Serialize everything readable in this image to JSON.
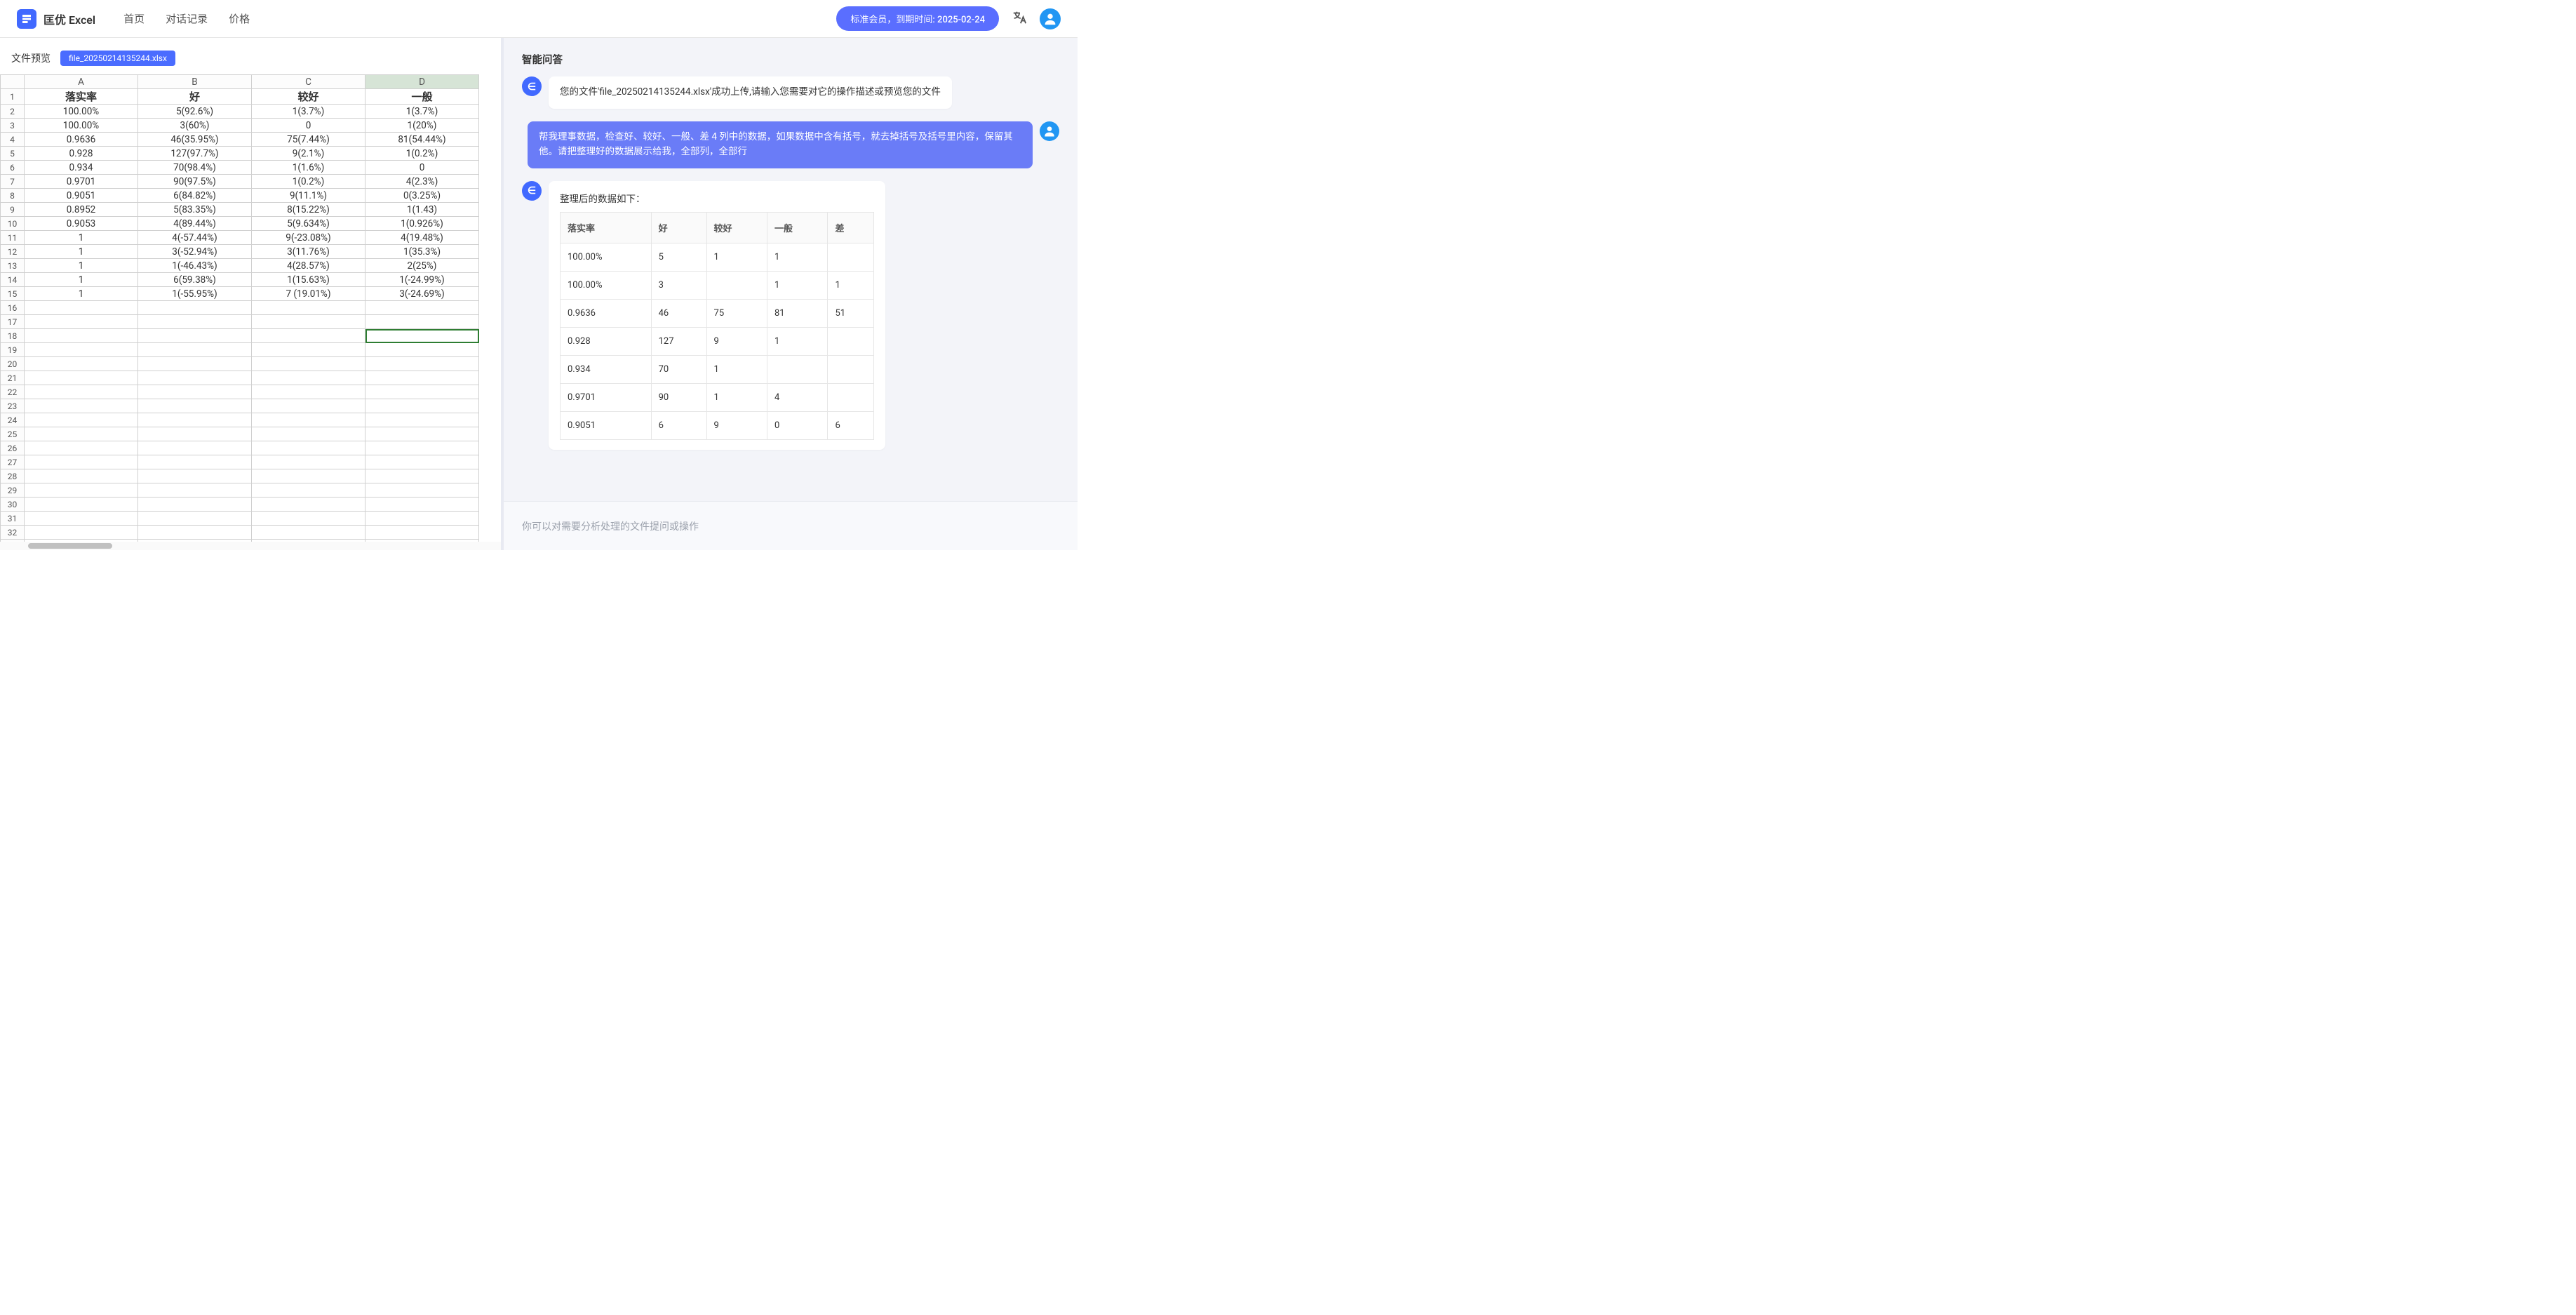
{
  "header": {
    "app_name": "匡优 Excel",
    "nav": {
      "home": "首页",
      "history": "对话记录",
      "pricing": "价格"
    },
    "member_badge": "标准会员，到期时间: 2025-02-24"
  },
  "left": {
    "preview_label": "文件预览",
    "file_name": "file_20250214135244.xlsx",
    "columns": [
      "A",
      "B",
      "C",
      "D"
    ],
    "selected_column_index": 3,
    "selected_cell": {
      "row": 18,
      "col": 3
    },
    "row_count": 34,
    "data_rows": [
      [
        "落实率",
        "好",
        "较好",
        "一般"
      ],
      [
        "100.00%",
        "5(92.6%)",
        "1(3.7%)",
        "1(3.7%)"
      ],
      [
        "100.00%",
        "3(60%)",
        "0",
        "1(20%)"
      ],
      [
        "0.9636",
        "46(35.95%)",
        "75(7.44%)",
        "81(54.44%)"
      ],
      [
        "0.928",
        "127(97.7%)",
        "9(2.1%)",
        "1(0.2%)"
      ],
      [
        "0.934",
        "70(98.4%)",
        "1(1.6%)",
        "0"
      ],
      [
        "0.9701",
        "90(97.5%)",
        "1(0.2%)",
        "4(2.3%)"
      ],
      [
        "0.9051",
        "6(84.82%)",
        "9(11.1%)",
        "0(3.25%)"
      ],
      [
        "0.8952",
        "5(83.35%)",
        "8(15.22%)",
        "1(1.43)"
      ],
      [
        "0.9053",
        "4(89.44%)",
        "5(9.634%)",
        "1(0.926%)"
      ],
      [
        "1",
        "4(-57.44%)",
        "9(-23.08%)",
        "4(19.48%)"
      ],
      [
        "1",
        "3(-52.94%)",
        "3(11.76%)",
        "1(35.3%)"
      ],
      [
        "1",
        "1(-46.43%)",
        "4(28.57%)",
        "2(25%)"
      ],
      [
        "1",
        "6(59.38%)",
        "1(15.63%)",
        "1(-24.99%)"
      ],
      [
        "1",
        "1(-55.95%)",
        "7 (19.01%)",
        "3(-24.69%)"
      ]
    ]
  },
  "chat": {
    "title": "智能问答",
    "bot_greeting": "您的文件'file_20250214135244.xlsx'成功上传,请输入您需要对它的操作描述或预览您的文件",
    "user_msg": "帮我理事数据，检查好、较好、一般、差 4 列中的数据，如果数据中含有括号，就去掉括号及括号里内容，保留其他。请把整理好的数据展示给我，全部列，全部行",
    "bot_reply_title": "整理后的数据如下：",
    "result_table": {
      "headers": [
        "落实率",
        "好",
        "较好",
        "一般",
        "差"
      ],
      "rows": [
        [
          "100.00%",
          "5",
          "1",
          "1",
          ""
        ],
        [
          "100.00%",
          "3",
          "",
          "1",
          "1"
        ],
        [
          "0.9636",
          "46",
          "75",
          "81",
          "51"
        ],
        [
          "0.928",
          "127",
          "9",
          "1",
          ""
        ],
        [
          "0.934",
          "70",
          "1",
          "",
          ""
        ],
        [
          "0.9701",
          "90",
          "1",
          "4",
          ""
        ],
        [
          "0.9051",
          "6",
          "9",
          "0",
          "6"
        ]
      ]
    },
    "input_placeholder": "你可以对需要分析处理的文件提问或操作"
  }
}
